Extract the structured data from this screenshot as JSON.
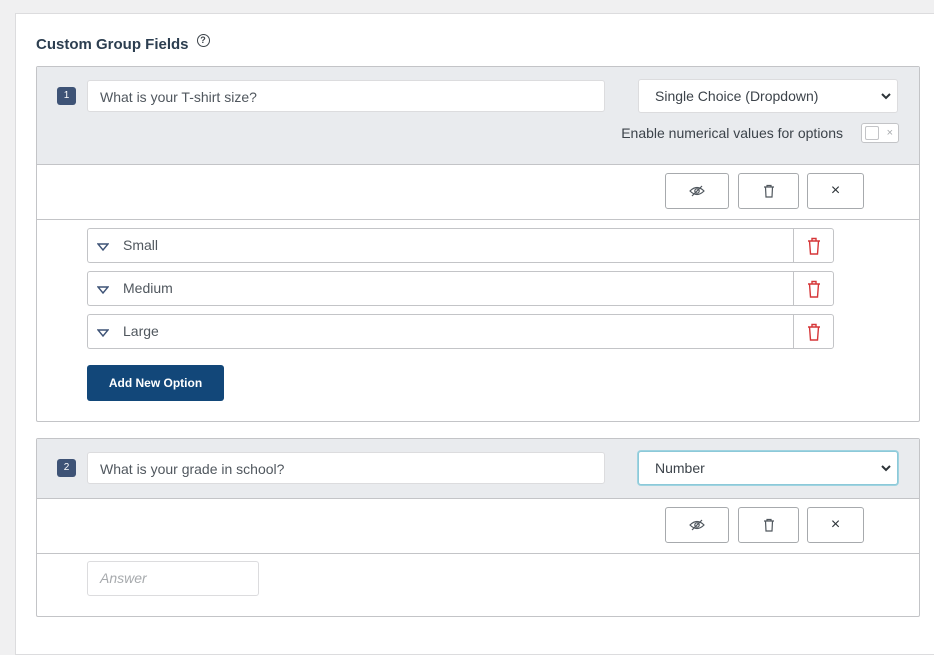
{
  "section": {
    "title": "Custom Group Fields"
  },
  "fields": [
    {
      "number": "1",
      "question": "What is your T-shirt size?",
      "type": "Single Choice (Dropdown)",
      "toggle_label": "Enable numerical values for options",
      "toggle_on": false,
      "toggle_off_glyph": "×",
      "options": [
        "Small",
        "Medium",
        "Large"
      ],
      "add_option_label": "Add New Option"
    },
    {
      "number": "2",
      "question": "What is your grade in school?",
      "type": "Number",
      "answer_placeholder": "Answer"
    }
  ],
  "actions": {
    "close_glyph": "×"
  },
  "icons": {
    "help": "help-circle-icon",
    "hide": "eye-slash-icon",
    "delete": "trash-icon",
    "close": "close-icon",
    "option_handle": "triangle-down-icon",
    "option_delete": "red-trash-icon"
  },
  "colors": {
    "primary_button": "#124779",
    "badge": "#3e5376",
    "danger": "#d63638",
    "focus": "#8cc9d9"
  }
}
